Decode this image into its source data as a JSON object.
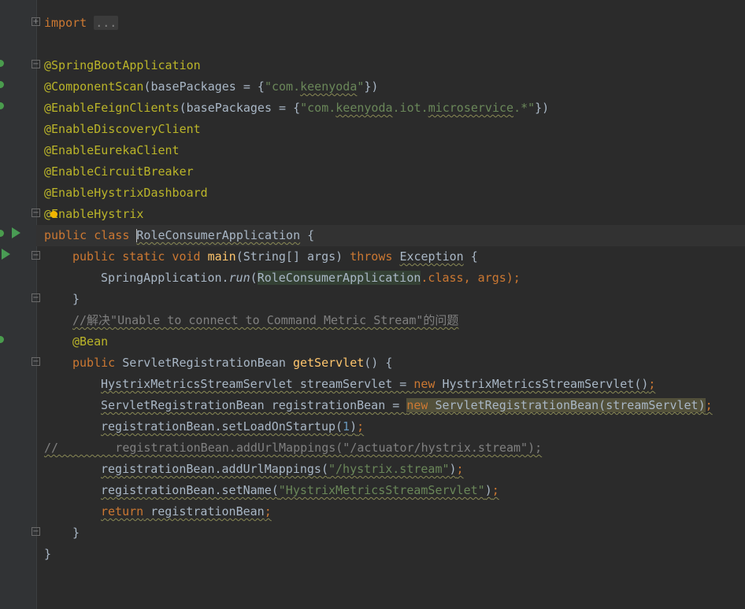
{
  "code": {
    "import_kw": "import",
    "import_collapsed": "...",
    "ann_springboot": "@SpringBootApplication",
    "ann_componentscan": "@ComponentScan",
    "componentscan_args_open": "(basePackages = {",
    "componentscan_str_a": "\"com.",
    "componentscan_str_b": "keenyoda",
    "componentscan_str_c": "\"",
    "componentscan_args_close": "})",
    "ann_feign": "@EnableFeignClients",
    "feign_args_open": "(basePackages = {",
    "feign_str_a": "\"com.",
    "feign_str_b": "keenyoda",
    "feign_str_c": ".iot.",
    "feign_str_d": "microservice",
    "feign_str_e": ".*\"",
    "feign_args_close": "})",
    "ann_discovery": "@EnableDiscoveryClient",
    "ann_eureka": "@EnableEurekaClient",
    "ann_circuit": "@EnableCircuitBreaker",
    "ann_dashboard": "@EnableHystrixDashboard",
    "ann_hystrix_a": "@",
    "ann_hystrix_b": "EnableHystrix",
    "class_public": "public",
    "class_kw": "class",
    "class_name": "RoleConsumerApplication",
    "class_brace": " {",
    "main_mods": "public static void",
    "main_name": "main",
    "main_params": "(String[] args) ",
    "main_throws": "throws",
    "main_exception": "Exception",
    "main_brace": " {",
    "run_target": "SpringApplication.",
    "run_method": "run",
    "run_paren_open": "(",
    "run_arg_class": "RoleConsumerApplication",
    "run_dot_class": ".class",
    "run_rest": ", args);",
    "close_brace": "}",
    "comment_chinese": "//解决\"Unable to connect to Command Metric Stream\"的问题",
    "ann_bean": "@Bean",
    "getservlet_public": "public",
    "getservlet_type": "ServletRegistrationBean",
    "getservlet_name": "getServlet",
    "getservlet_rest": "() {",
    "l1_type": "HystrixMetricsStreamServlet streamServlet = ",
    "l1_new": "new",
    "l1_rest": " HystrixMetricsStreamServlet()",
    "l1_semi": ";",
    "l2_type": "ServletRegistrationBean registrationBean = ",
    "l2_new": "new",
    "l2_rest": " ServletRegistrationBean(streamServlet)",
    "l2_semi": ";",
    "l3_a": "registrationBean.setLoadOnStartup(",
    "l3_num": "1",
    "l3_b": ")",
    "l3_semi": ";",
    "l4_comment": "//        registrationBean.addUrlMappings(\"/actuator/hystrix.stream\");",
    "l5_a": "registrationBean.addUrlMappings(",
    "l5_str": "\"/hystrix.stream\"",
    "l5_b": ")",
    "l5_semi": ";",
    "l6_a": "registrationBean.setName(",
    "l6_str": "\"HystrixMetricsStreamServlet\"",
    "l6_b": ")",
    "l6_semi": ";",
    "l7_return": "return",
    "l7_rest": " registrationBean",
    "l7_semi": ";"
  },
  "colors": {
    "background": "#2b2b2b",
    "gutter": "#313335",
    "keyword": "#cc7832",
    "annotation": "#bbb529",
    "string": "#6a8759",
    "number": "#6897bb",
    "comment": "#808080",
    "function": "#ffc66d",
    "text": "#a9b7c6",
    "run_icon": "#499c54"
  },
  "icons": [
    "fold-plus-icon",
    "fold-minus-icon",
    "run-icon",
    "bean-icon",
    "lightbulb-icon"
  ]
}
